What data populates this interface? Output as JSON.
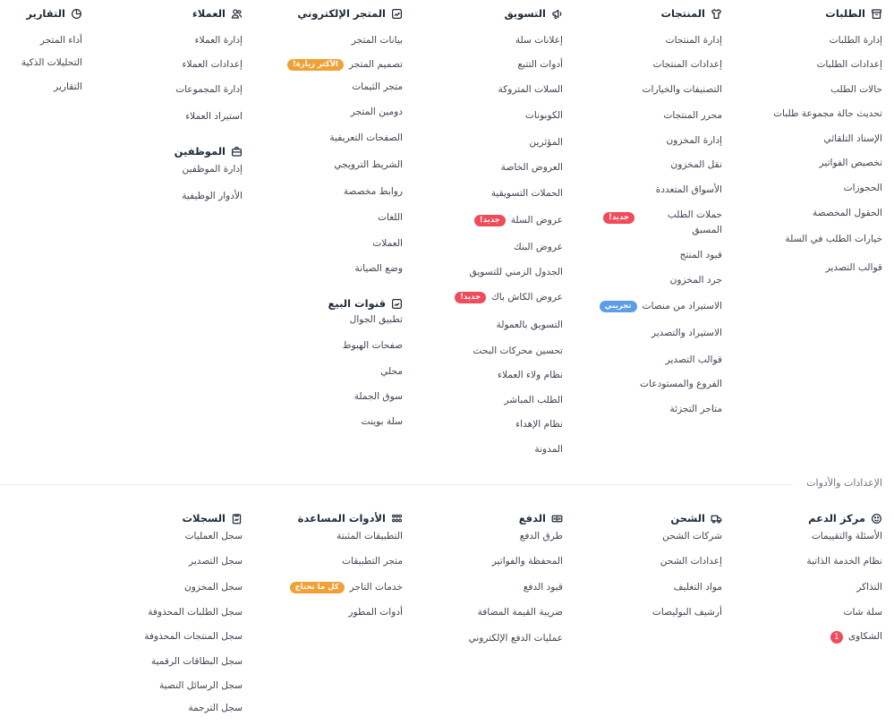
{
  "sections": {
    "orders": {
      "title": "الطلبات",
      "items": [
        {
          "label": "إدارة الطلبات"
        },
        {
          "label": "إعدادات الطلبات"
        },
        {
          "label": "حالات الطلب"
        },
        {
          "label": "تحديث حالة مجموعة طلبات"
        },
        {
          "label": "الإسناد التلقائي"
        },
        {
          "label": "تخصيص الفواتير"
        },
        {
          "label": "الحجوزات"
        },
        {
          "label": "الحقول المخصصة"
        },
        {
          "label": "خيارات الطلب في السلة"
        },
        {
          "label": "قوالب التصدير"
        }
      ]
    },
    "products": {
      "title": "المنتجات",
      "items": [
        {
          "label": "إدارة المنتجات"
        },
        {
          "label": "إعدادات المنتجات"
        },
        {
          "label": "التصنيفات والخيارات"
        },
        {
          "label": "محرر المنتجات"
        },
        {
          "label": "إدارة المخزون"
        },
        {
          "label": "نقل المخزون"
        },
        {
          "label": "الأسواق المتعددة"
        },
        {
          "label": "حملات الطلب المسبق",
          "badge": "جديد!"
        },
        {
          "label": "قيود المنتج"
        },
        {
          "label": "جرد المخزون"
        },
        {
          "label": "الاستيراد من منصات",
          "badge": "تجريبي"
        },
        {
          "label": "الاستيراد والتصدير"
        },
        {
          "label": "قوالب التصدير"
        },
        {
          "label": "الفروع والمستودعات"
        },
        {
          "label": "متاجر التجزئة"
        }
      ]
    },
    "marketing": {
      "title": "التسويق",
      "items": [
        {
          "label": "إعلانات سلة"
        },
        {
          "label": "أدوات التتبع"
        },
        {
          "label": "السلات المتروكة"
        },
        {
          "label": "الكوبونات"
        },
        {
          "label": "المؤثرين"
        },
        {
          "label": "العروض الخاصة"
        },
        {
          "label": "الحملات التسويقية"
        },
        {
          "label": "عروض السلة",
          "badge": "جديد!"
        },
        {
          "label": "عروض البنك"
        },
        {
          "label": "الجدول الزمني للتسويق"
        },
        {
          "label": "عروض الكاش باك",
          "badge": "جديد!"
        },
        {
          "label": "التسويق بالعمولة"
        },
        {
          "label": "تحسين محركات البحث"
        },
        {
          "label": "نظام ولاء العملاء"
        },
        {
          "label": "الطلب المباشر"
        },
        {
          "label": "نظام الإهداء"
        },
        {
          "label": "المدونة"
        }
      ]
    },
    "store": {
      "title": "المتجر الإلكتروني",
      "items": [
        {
          "label": "بيانات المتجر"
        },
        {
          "label": "تصميم المتجر",
          "badge": "الأكثر زيارة!"
        },
        {
          "label": "متجر الثيمات"
        },
        {
          "label": "دومين المتجر"
        },
        {
          "label": "الصفحات التعريفية"
        },
        {
          "label": "الشريط الترويجي"
        },
        {
          "label": "روابط مخصصة"
        },
        {
          "label": "اللغات"
        },
        {
          "label": "العملات"
        },
        {
          "label": "وضع الصيانة"
        }
      ]
    },
    "channels": {
      "title": "قنوات البيع",
      "items": [
        {
          "label": "تطبيق الجوال"
        },
        {
          "label": "صفحات الهبوط"
        },
        {
          "label": "محلي"
        },
        {
          "label": "سوق الجملة"
        },
        {
          "label": "سلة بوينت"
        }
      ]
    },
    "customers": {
      "title": "العملاء",
      "items": [
        {
          "label": "إدارة العملاء"
        },
        {
          "label": "إعدادات العملاء"
        },
        {
          "label": "إدارة المجموعات"
        },
        {
          "label": "استيراد العملاء"
        }
      ]
    },
    "employees": {
      "title": "الموظفين",
      "items": [
        {
          "label": "إدارة الموظفين"
        },
        {
          "label": "الأدوار الوظيفية"
        }
      ]
    },
    "reports": {
      "title": "التقارير",
      "items": [
        {
          "label": "أداء المتجر"
        },
        {
          "label": "التحليلات الذكية"
        },
        {
          "label": "التقارير"
        }
      ]
    },
    "settings_title": "الإعدادات والأدوات",
    "support": {
      "title": "مركز الدعم",
      "items": [
        {
          "label": "الأسئلة والتقييمات"
        },
        {
          "label": "نظام الخدمة الذاتية"
        },
        {
          "label": "التذاكر"
        },
        {
          "label": "سلة شات"
        },
        {
          "label": "الشكاوى",
          "count": "1"
        }
      ]
    },
    "shipping": {
      "title": "الشحن",
      "items": [
        {
          "label": "شركات الشحن"
        },
        {
          "label": "إعدادات الشحن"
        },
        {
          "label": "مواد التغليف"
        },
        {
          "label": "أرشيف البوليصات"
        }
      ]
    },
    "payment": {
      "title": "الدفع",
      "items": [
        {
          "label": "طرق الدفع"
        },
        {
          "label": "المحفظة والفواتير"
        },
        {
          "label": "قيود الدفع"
        },
        {
          "label": "ضريبة القيمة المضافة"
        },
        {
          "label": "عمليات الدفع الإلكتروني"
        }
      ]
    },
    "tools": {
      "title": "الأدوات المساعدة",
      "items": [
        {
          "label": "التطبيقات المثبتة"
        },
        {
          "label": "متجر التطبيقات"
        },
        {
          "label": "خدمات التاجر",
          "badge": "كل ما تحتاج"
        },
        {
          "label": "أدوات المطور"
        }
      ]
    },
    "logs": {
      "title": "السجلات",
      "items": [
        {
          "label": "سجل العمليات"
        },
        {
          "label": "سجل التصدير"
        },
        {
          "label": "سجل المخزون"
        },
        {
          "label": "سجل الطلبات المحذوفة"
        },
        {
          "label": "سجل المنتجات المحذوفة"
        },
        {
          "label": "سجل البطاقات الرقمية"
        },
        {
          "label": "سجل الرسائل النصية"
        },
        {
          "label": "سجل الترجمة"
        }
      ]
    }
  },
  "icons": {
    "orders": "box-icon",
    "products": "shirt-icon",
    "marketing": "megaphone-icon",
    "store": "storefront-icon",
    "customers": "users-icon",
    "reports": "pie-chart-icon",
    "employees": "briefcase-icon",
    "channels": "channels-icon",
    "support": "smile-icon",
    "shipping": "truck-icon",
    "payment": "money-icon",
    "tools": "grid-icon",
    "logs": "clipboard-icon"
  },
  "colors": {
    "badge_orange": "#f0a136",
    "badge_red": "#ef4b5a",
    "badge_blue": "#5b9de8",
    "count_red": "#ef4b5a"
  }
}
